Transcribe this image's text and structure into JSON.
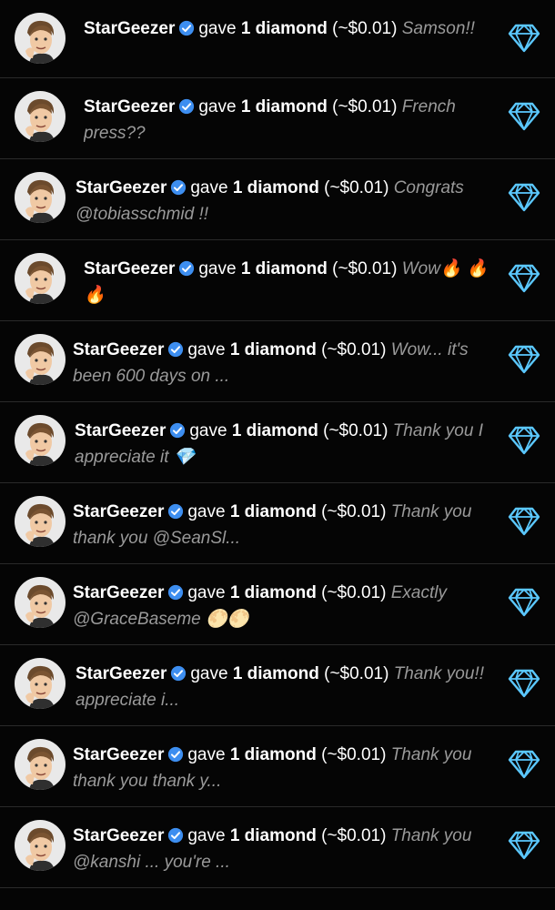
{
  "feed": {
    "accent_color": "#5bc8ff",
    "verified_color": "#3d8ef0",
    "items": [
      {
        "user": "StarGeezer",
        "action": "gave",
        "amount": "1 diamond",
        "value": "(~$0.01)",
        "message": "Samson!!",
        "icon": "diamond-icon"
      },
      {
        "user": "StarGeezer",
        "action": "gave",
        "amount": "1 diamond",
        "value": "(~$0.01)",
        "message": "French press??",
        "icon": "diamond-icon"
      },
      {
        "user": "StarGeezer",
        "action": "gave",
        "amount": "1 diamond",
        "value": "(~$0.01)",
        "message": "Congrats @tobiasschmid !!",
        "icon": "diamond-icon"
      },
      {
        "user": "StarGeezer",
        "action": "gave",
        "amount": "1 diamond",
        "value": "(~$0.01)",
        "message": "Wow🔥 🔥🔥",
        "icon": "diamond-icon"
      },
      {
        "user": "StarGeezer",
        "action": "gave",
        "amount": "1 diamond",
        "value": "(~$0.01)",
        "message": "Wow... it's been 600 days on ...",
        "icon": "diamond-icon"
      },
      {
        "user": "StarGeezer",
        "action": "gave",
        "amount": "1 diamond",
        "value": "(~$0.01)",
        "message": "Thank you I appreciate it 💎",
        "icon": "diamond-icon"
      },
      {
        "user": "StarGeezer",
        "action": "gave",
        "amount": "1 diamond",
        "value": "(~$0.01)",
        "message": "Thank you thank you @SeanSl...",
        "icon": "diamond-icon"
      },
      {
        "user": "StarGeezer",
        "action": "gave",
        "amount": "1 diamond",
        "value": "(~$0.01)",
        "message": "Exactly @GraceBaseme 🌕🌕",
        "icon": "diamond-icon"
      },
      {
        "user": "StarGeezer",
        "action": "gave",
        "amount": "1 diamond",
        "value": "(~$0.01)",
        "message": "Thank you!! appreciate i...",
        "icon": "diamond-icon"
      },
      {
        "user": "StarGeezer",
        "action": "gave",
        "amount": "1 diamond",
        "value": "(~$0.01)",
        "message": "Thank you thank you thank y...",
        "icon": "diamond-icon"
      },
      {
        "user": "StarGeezer",
        "action": "gave",
        "amount": "1 diamond",
        "value": "(~$0.01)",
        "message": "Thank you @kanshi ... you're ...",
        "icon": "diamond-icon"
      }
    ]
  }
}
